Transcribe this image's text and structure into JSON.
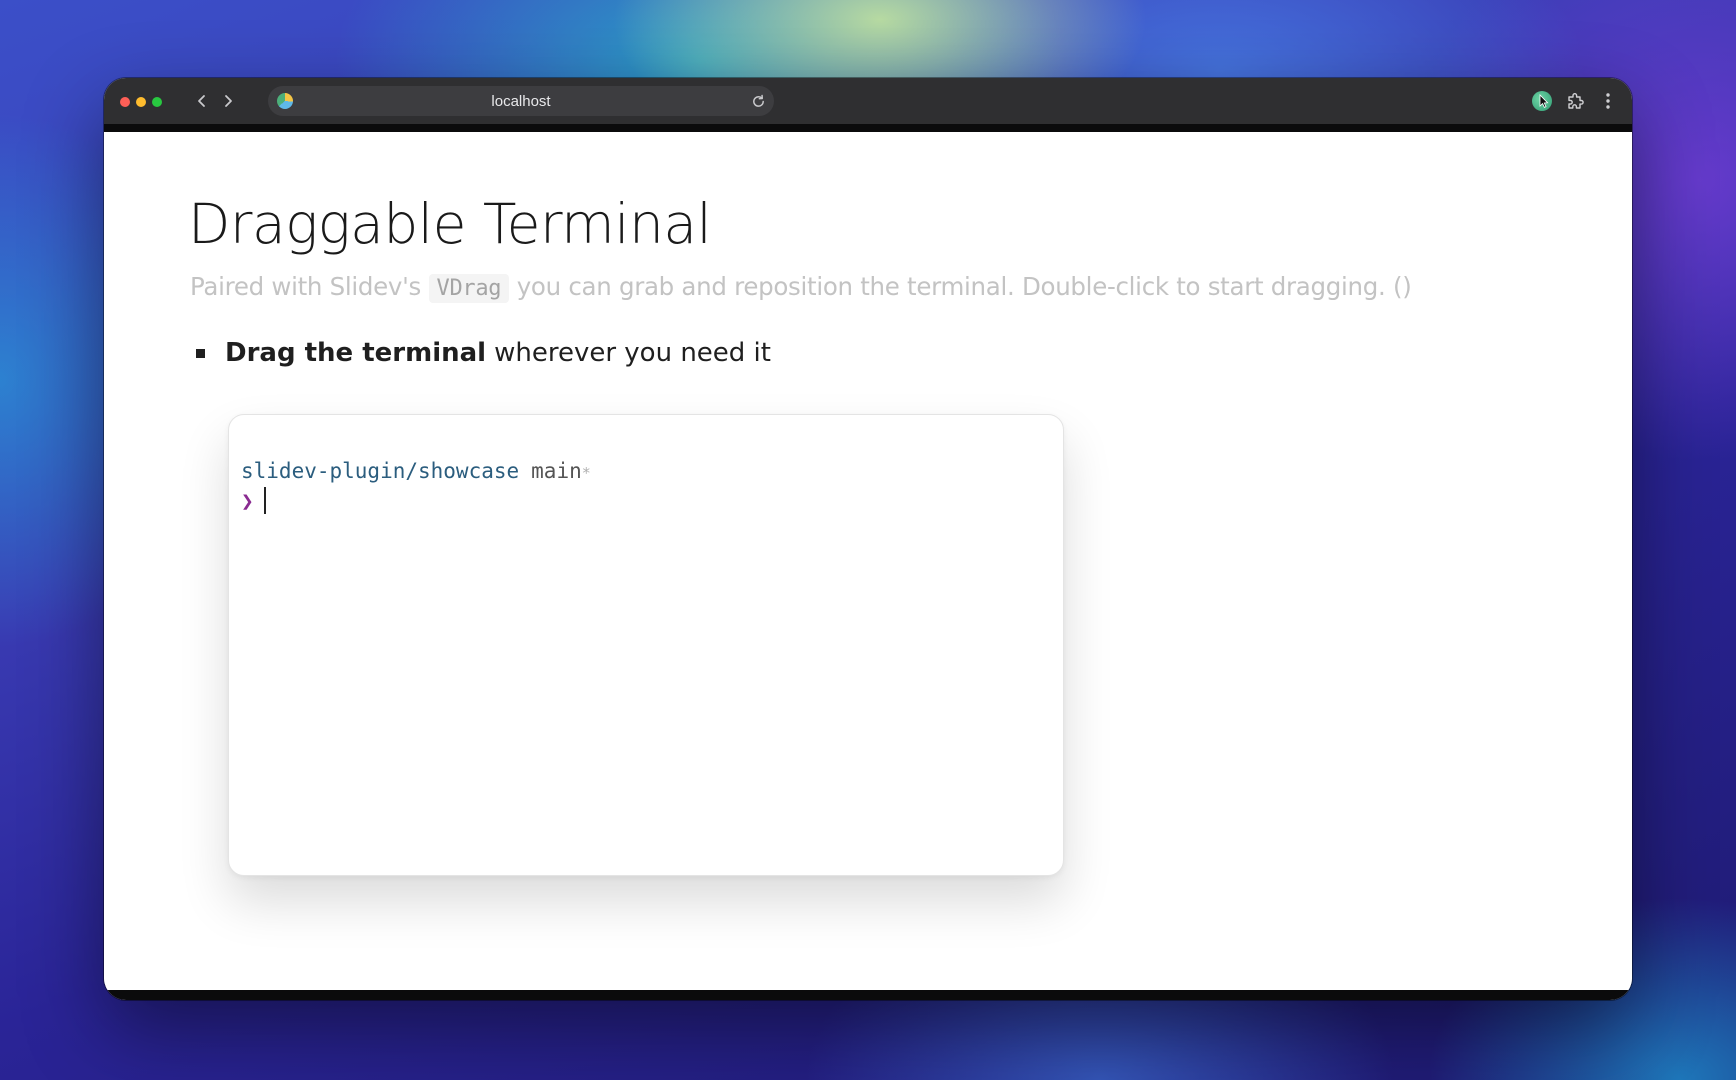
{
  "browser": {
    "url": "localhost"
  },
  "slide": {
    "title": "Draggable Terminal",
    "subtitle_before": "Paired with Slidev's",
    "subtitle_code": "VDrag",
    "subtitle_after": "you can grab and reposition the terminal. Double-click to start dragging. ()",
    "bullet_bold": "Drag the terminal",
    "bullet_rest": "wherever you need it"
  },
  "terminal": {
    "path": "slidev-plugin/showcase",
    "branch": "main",
    "dirty_marker": "*",
    "prompt_symbol": "❯"
  },
  "colors": {
    "prompt": "#8a2b91",
    "path": "#2b5d7e"
  },
  "icons": [
    "back-arrow-icon",
    "forward-arrow-icon",
    "site-icon",
    "reload-icon",
    "profile-icon",
    "extensions-puzzle-icon",
    "more-menu-icon"
  ]
}
